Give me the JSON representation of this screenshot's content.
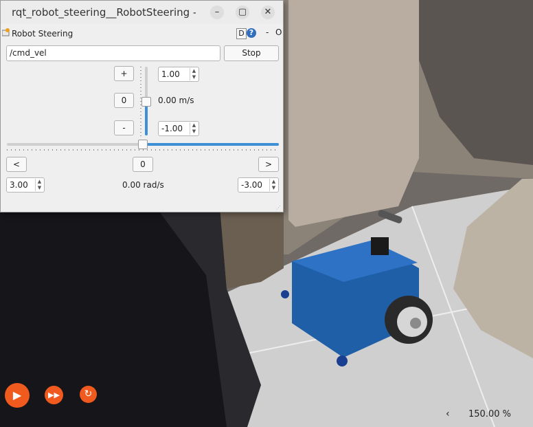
{
  "window": {
    "title": "rqt_robot_steering__RobotSteering - r",
    "minimize": "–",
    "maximize": "▢",
    "close": "✕"
  },
  "plugin": {
    "title": "Robot Steering",
    "d_label": "D",
    "help_label": "?",
    "minimize_label": "-",
    "close_label": "O"
  },
  "topic": {
    "value": "/cmd_vel",
    "stop_label": "Stop"
  },
  "linear": {
    "plus_label": "+",
    "zero_label": "0",
    "minus_label": "-",
    "max_value": "1.00",
    "min_value": "-1.00",
    "current": "0.00 m/s",
    "level": 0.5
  },
  "angular": {
    "left_label": "<",
    "zero_label": "0",
    "right_label": ">",
    "max_value": "3.00",
    "min_value": "-3.00",
    "current": "0.00 rad/s",
    "level": 0.5
  },
  "gazebo": {
    "play_icon": "play-icon",
    "step_icon": "fast-forward-icon",
    "reset_icon": "reset-icon",
    "zoom_arrow": "‹",
    "zoom": "150.00 %"
  },
  "colors": {
    "accent": "#3d8fd6",
    "gazebo_button": "#f05a1e",
    "robot_body": "#1f5fa8"
  }
}
